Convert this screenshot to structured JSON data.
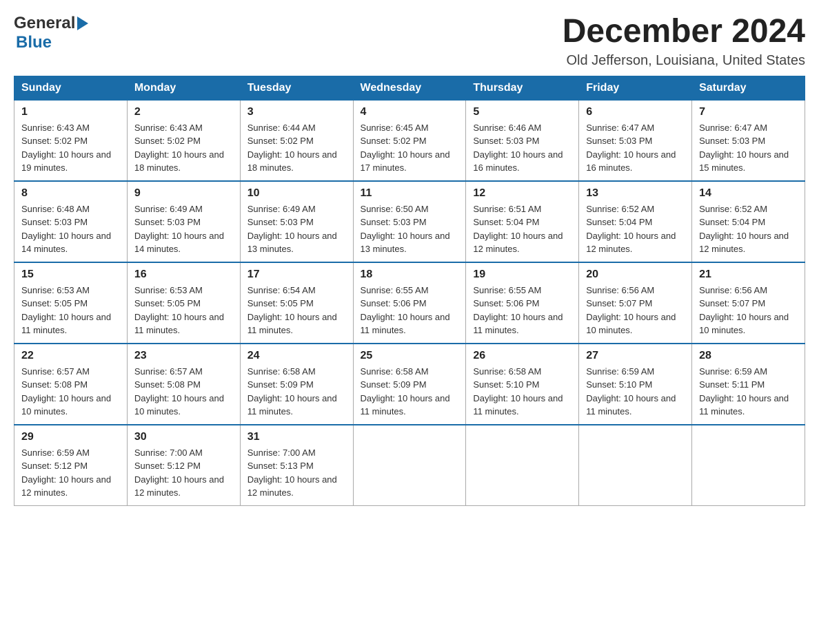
{
  "header": {
    "logo": {
      "general": "General",
      "blue": "Blue",
      "line1": "General",
      "line2": "Blue"
    },
    "title": "December 2024",
    "location": "Old Jefferson, Louisiana, United States"
  },
  "days_of_week": [
    "Sunday",
    "Monday",
    "Tuesday",
    "Wednesday",
    "Thursday",
    "Friday",
    "Saturday"
  ],
  "weeks": [
    [
      {
        "day": "1",
        "sunrise": "6:43 AM",
        "sunset": "5:02 PM",
        "daylight": "10 hours and 19 minutes."
      },
      {
        "day": "2",
        "sunrise": "6:43 AM",
        "sunset": "5:02 PM",
        "daylight": "10 hours and 18 minutes."
      },
      {
        "day": "3",
        "sunrise": "6:44 AM",
        "sunset": "5:02 PM",
        "daylight": "10 hours and 18 minutes."
      },
      {
        "day": "4",
        "sunrise": "6:45 AM",
        "sunset": "5:02 PM",
        "daylight": "10 hours and 17 minutes."
      },
      {
        "day": "5",
        "sunrise": "6:46 AM",
        "sunset": "5:03 PM",
        "daylight": "10 hours and 16 minutes."
      },
      {
        "day": "6",
        "sunrise": "6:47 AM",
        "sunset": "5:03 PM",
        "daylight": "10 hours and 16 minutes."
      },
      {
        "day": "7",
        "sunrise": "6:47 AM",
        "sunset": "5:03 PM",
        "daylight": "10 hours and 15 minutes."
      }
    ],
    [
      {
        "day": "8",
        "sunrise": "6:48 AM",
        "sunset": "5:03 PM",
        "daylight": "10 hours and 14 minutes."
      },
      {
        "day": "9",
        "sunrise": "6:49 AM",
        "sunset": "5:03 PM",
        "daylight": "10 hours and 14 minutes."
      },
      {
        "day": "10",
        "sunrise": "6:49 AM",
        "sunset": "5:03 PM",
        "daylight": "10 hours and 13 minutes."
      },
      {
        "day": "11",
        "sunrise": "6:50 AM",
        "sunset": "5:03 PM",
        "daylight": "10 hours and 13 minutes."
      },
      {
        "day": "12",
        "sunrise": "6:51 AM",
        "sunset": "5:04 PM",
        "daylight": "10 hours and 12 minutes."
      },
      {
        "day": "13",
        "sunrise": "6:52 AM",
        "sunset": "5:04 PM",
        "daylight": "10 hours and 12 minutes."
      },
      {
        "day": "14",
        "sunrise": "6:52 AM",
        "sunset": "5:04 PM",
        "daylight": "10 hours and 12 minutes."
      }
    ],
    [
      {
        "day": "15",
        "sunrise": "6:53 AM",
        "sunset": "5:05 PM",
        "daylight": "10 hours and 11 minutes."
      },
      {
        "day": "16",
        "sunrise": "6:53 AM",
        "sunset": "5:05 PM",
        "daylight": "10 hours and 11 minutes."
      },
      {
        "day": "17",
        "sunrise": "6:54 AM",
        "sunset": "5:05 PM",
        "daylight": "10 hours and 11 minutes."
      },
      {
        "day": "18",
        "sunrise": "6:55 AM",
        "sunset": "5:06 PM",
        "daylight": "10 hours and 11 minutes."
      },
      {
        "day": "19",
        "sunrise": "6:55 AM",
        "sunset": "5:06 PM",
        "daylight": "10 hours and 11 minutes."
      },
      {
        "day": "20",
        "sunrise": "6:56 AM",
        "sunset": "5:07 PM",
        "daylight": "10 hours and 10 minutes."
      },
      {
        "day": "21",
        "sunrise": "6:56 AM",
        "sunset": "5:07 PM",
        "daylight": "10 hours and 10 minutes."
      }
    ],
    [
      {
        "day": "22",
        "sunrise": "6:57 AM",
        "sunset": "5:08 PM",
        "daylight": "10 hours and 10 minutes."
      },
      {
        "day": "23",
        "sunrise": "6:57 AM",
        "sunset": "5:08 PM",
        "daylight": "10 hours and 10 minutes."
      },
      {
        "day": "24",
        "sunrise": "6:58 AM",
        "sunset": "5:09 PM",
        "daylight": "10 hours and 11 minutes."
      },
      {
        "day": "25",
        "sunrise": "6:58 AM",
        "sunset": "5:09 PM",
        "daylight": "10 hours and 11 minutes."
      },
      {
        "day": "26",
        "sunrise": "6:58 AM",
        "sunset": "5:10 PM",
        "daylight": "10 hours and 11 minutes."
      },
      {
        "day": "27",
        "sunrise": "6:59 AM",
        "sunset": "5:10 PM",
        "daylight": "10 hours and 11 minutes."
      },
      {
        "day": "28",
        "sunrise": "6:59 AM",
        "sunset": "5:11 PM",
        "daylight": "10 hours and 11 minutes."
      }
    ],
    [
      {
        "day": "29",
        "sunrise": "6:59 AM",
        "sunset": "5:12 PM",
        "daylight": "10 hours and 12 minutes."
      },
      {
        "day": "30",
        "sunrise": "7:00 AM",
        "sunset": "5:12 PM",
        "daylight": "10 hours and 12 minutes."
      },
      {
        "day": "31",
        "sunrise": "7:00 AM",
        "sunset": "5:13 PM",
        "daylight": "10 hours and 12 minutes."
      },
      null,
      null,
      null,
      null
    ]
  ],
  "labels": {
    "sunrise": "Sunrise:",
    "sunset": "Sunset:",
    "daylight": "Daylight:"
  }
}
